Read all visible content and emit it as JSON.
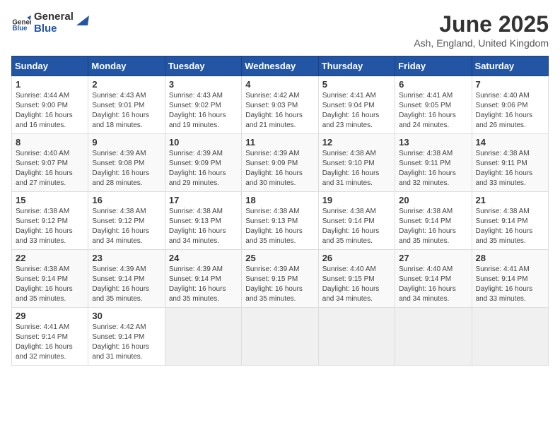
{
  "header": {
    "logo_general": "General",
    "logo_blue": "Blue",
    "month_title": "June 2025",
    "location": "Ash, England, United Kingdom"
  },
  "calendar": {
    "days_of_week": [
      "Sunday",
      "Monday",
      "Tuesday",
      "Wednesday",
      "Thursday",
      "Friday",
      "Saturday"
    ],
    "weeks": [
      [
        {
          "day": "1",
          "info": "Sunrise: 4:44 AM\nSunset: 9:00 PM\nDaylight: 16 hours\nand 16 minutes."
        },
        {
          "day": "2",
          "info": "Sunrise: 4:43 AM\nSunset: 9:01 PM\nDaylight: 16 hours\nand 18 minutes."
        },
        {
          "day": "3",
          "info": "Sunrise: 4:43 AM\nSunset: 9:02 PM\nDaylight: 16 hours\nand 19 minutes."
        },
        {
          "day": "4",
          "info": "Sunrise: 4:42 AM\nSunset: 9:03 PM\nDaylight: 16 hours\nand 21 minutes."
        },
        {
          "day": "5",
          "info": "Sunrise: 4:41 AM\nSunset: 9:04 PM\nDaylight: 16 hours\nand 23 minutes."
        },
        {
          "day": "6",
          "info": "Sunrise: 4:41 AM\nSunset: 9:05 PM\nDaylight: 16 hours\nand 24 minutes."
        },
        {
          "day": "7",
          "info": "Sunrise: 4:40 AM\nSunset: 9:06 PM\nDaylight: 16 hours\nand 26 minutes."
        }
      ],
      [
        {
          "day": "8",
          "info": "Sunrise: 4:40 AM\nSunset: 9:07 PM\nDaylight: 16 hours\nand 27 minutes."
        },
        {
          "day": "9",
          "info": "Sunrise: 4:39 AM\nSunset: 9:08 PM\nDaylight: 16 hours\nand 28 minutes."
        },
        {
          "day": "10",
          "info": "Sunrise: 4:39 AM\nSunset: 9:09 PM\nDaylight: 16 hours\nand 29 minutes."
        },
        {
          "day": "11",
          "info": "Sunrise: 4:39 AM\nSunset: 9:09 PM\nDaylight: 16 hours\nand 30 minutes."
        },
        {
          "day": "12",
          "info": "Sunrise: 4:38 AM\nSunset: 9:10 PM\nDaylight: 16 hours\nand 31 minutes."
        },
        {
          "day": "13",
          "info": "Sunrise: 4:38 AM\nSunset: 9:11 PM\nDaylight: 16 hours\nand 32 minutes."
        },
        {
          "day": "14",
          "info": "Sunrise: 4:38 AM\nSunset: 9:11 PM\nDaylight: 16 hours\nand 33 minutes."
        }
      ],
      [
        {
          "day": "15",
          "info": "Sunrise: 4:38 AM\nSunset: 9:12 PM\nDaylight: 16 hours\nand 33 minutes."
        },
        {
          "day": "16",
          "info": "Sunrise: 4:38 AM\nSunset: 9:12 PM\nDaylight: 16 hours\nand 34 minutes."
        },
        {
          "day": "17",
          "info": "Sunrise: 4:38 AM\nSunset: 9:13 PM\nDaylight: 16 hours\nand 34 minutes."
        },
        {
          "day": "18",
          "info": "Sunrise: 4:38 AM\nSunset: 9:13 PM\nDaylight: 16 hours\nand 35 minutes."
        },
        {
          "day": "19",
          "info": "Sunrise: 4:38 AM\nSunset: 9:14 PM\nDaylight: 16 hours\nand 35 minutes."
        },
        {
          "day": "20",
          "info": "Sunrise: 4:38 AM\nSunset: 9:14 PM\nDaylight: 16 hours\nand 35 minutes."
        },
        {
          "day": "21",
          "info": "Sunrise: 4:38 AM\nSunset: 9:14 PM\nDaylight: 16 hours\nand 35 minutes."
        }
      ],
      [
        {
          "day": "22",
          "info": "Sunrise: 4:38 AM\nSunset: 9:14 PM\nDaylight: 16 hours\nand 35 minutes."
        },
        {
          "day": "23",
          "info": "Sunrise: 4:39 AM\nSunset: 9:14 PM\nDaylight: 16 hours\nand 35 minutes."
        },
        {
          "day": "24",
          "info": "Sunrise: 4:39 AM\nSunset: 9:14 PM\nDaylight: 16 hours\nand 35 minutes."
        },
        {
          "day": "25",
          "info": "Sunrise: 4:39 AM\nSunset: 9:15 PM\nDaylight: 16 hours\nand 35 minutes."
        },
        {
          "day": "26",
          "info": "Sunrise: 4:40 AM\nSunset: 9:15 PM\nDaylight: 16 hours\nand 34 minutes."
        },
        {
          "day": "27",
          "info": "Sunrise: 4:40 AM\nSunset: 9:14 PM\nDaylight: 16 hours\nand 34 minutes."
        },
        {
          "day": "28",
          "info": "Sunrise: 4:41 AM\nSunset: 9:14 PM\nDaylight: 16 hours\nand 33 minutes."
        }
      ],
      [
        {
          "day": "29",
          "info": "Sunrise: 4:41 AM\nSunset: 9:14 PM\nDaylight: 16 hours\nand 32 minutes."
        },
        {
          "day": "30",
          "info": "Sunrise: 4:42 AM\nSunset: 9:14 PM\nDaylight: 16 hours\nand 31 minutes."
        },
        null,
        null,
        null,
        null,
        null
      ]
    ]
  }
}
